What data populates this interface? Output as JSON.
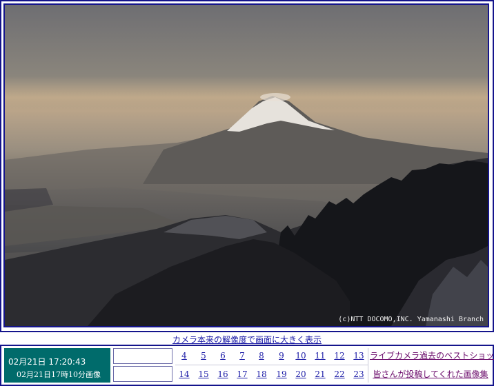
{
  "camera": {
    "copyright": "(c)NTT DOCOMO,INC. Yamanashi Branch"
  },
  "fullres_link": "カメラ本来の解像度で画面に大きく表示",
  "timestamp": {
    "current": "02月21日  17:20:43",
    "image_caption": "02月21日17時10分画像"
  },
  "hours_row1": [
    "4",
    "5",
    "6",
    "7",
    "8",
    "9",
    "10",
    "11",
    "12",
    "13"
  ],
  "hours_row2": [
    "14",
    "15",
    "16",
    "17",
    "18",
    "19",
    "20",
    "21",
    "22",
    "23"
  ],
  "links": {
    "best_shot": "ライブカメラ過去のベストショット",
    "user_gallery": "皆さんが投稿してくれた画像集"
  },
  "colors": {
    "frame": "#14148c",
    "timebox_bg": "#006b6b",
    "link": "#1a1aa6",
    "visited_link": "#6a0a6a"
  }
}
